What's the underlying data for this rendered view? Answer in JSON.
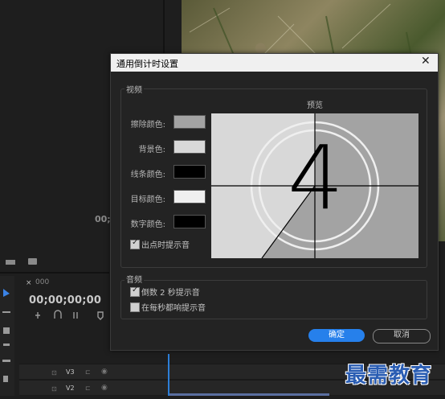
{
  "app": {
    "source_timecode": "00;0",
    "timeline_timecode": "00;00;00;00",
    "sequence_tab": "000",
    "tracks": [
      {
        "name": "V3"
      },
      {
        "name": "V2"
      }
    ]
  },
  "dialog": {
    "title": "通用倒计时设置",
    "close_glyph": "✕",
    "video": {
      "title": "视频",
      "preview_label": "预览",
      "preview_number": "4",
      "colors": [
        {
          "label": "擦除颜色:",
          "color": "#a3a3a3"
        },
        {
          "label": "背景色:",
          "color": "#d8d8d8"
        },
        {
          "label": "线条颜色:",
          "color": "#000000"
        },
        {
          "label": "目标颜色:",
          "color": "#efefef"
        },
        {
          "label": "数字颜色:",
          "color": "#000000"
        }
      ],
      "cue_on_out": {
        "label": "出点时提示音",
        "checked": true
      }
    },
    "audio": {
      "title": "音频",
      "cue_two_sec": {
        "label": "倒数 2 秒提示音",
        "checked": true
      },
      "cue_each_sec": {
        "label": "在每秒都响提示音",
        "checked": false
      }
    },
    "buttons": {
      "ok": "确定",
      "cancel": "取消"
    }
  },
  "watermark": "最需教育",
  "colors": {
    "accent": "#2680eb",
    "playhead": "#2d7fd8",
    "watermark": "#2a5db3"
  }
}
